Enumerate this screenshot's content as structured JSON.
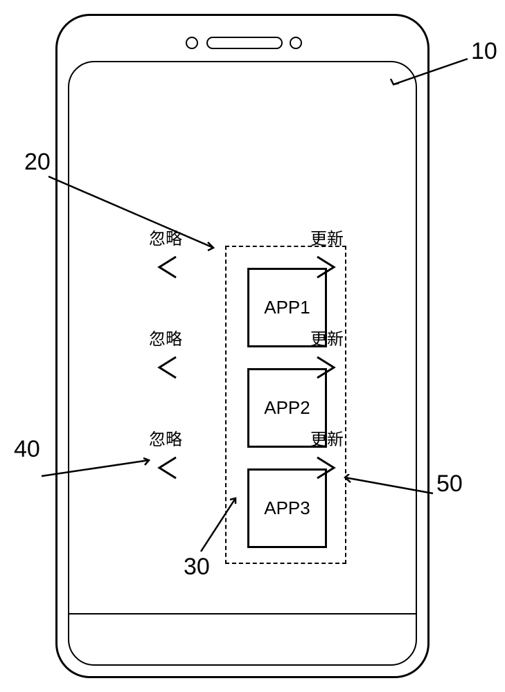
{
  "apps": {
    "a1": "APP1",
    "a2": "APP2",
    "a3": "APP3"
  },
  "labels": {
    "ignore": "忽略",
    "update": "更新"
  },
  "callouts": {
    "c10": "10",
    "c20": "20",
    "c30": "30",
    "c40": "40",
    "c50": "50"
  }
}
